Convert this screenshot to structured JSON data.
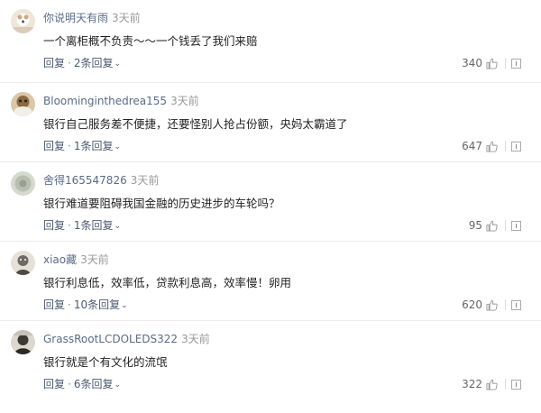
{
  "labels": {
    "reply": "回复",
    "dot": "·"
  },
  "comments": [
    {
      "username": "你说明天有雨",
      "time": "3天前",
      "content": "一个离柜概不负责～～一个钱丢了我们来赔",
      "replies": "2条回复",
      "likes": "340"
    },
    {
      "username": "Bloominginthedrea155",
      "time": "3天前",
      "content": "银行自己服务差不便捷，还要怪别人抢占份额，央妈太霸道了",
      "replies": "1条回复",
      "likes": "647"
    },
    {
      "username": "舍得165547826",
      "time": "3天前",
      "content": "银行难道要阻碍我国金融的历史进步的车轮吗？",
      "replies": "1条回复",
      "likes": "95"
    },
    {
      "username": "xiao藏",
      "time": "3天前",
      "content": "银行利息低，效率低，贷款利息高，效率慢！卵用",
      "replies": "10条回复",
      "likes": "620"
    },
    {
      "username": "GrassRootLCDOLEDS322",
      "time": "3天前",
      "content": "银行就是个有文化的流氓",
      "replies": "6条回复",
      "likes": "322"
    }
  ],
  "colors": {
    "username": "#5a6b86",
    "time": "#999999",
    "link": "#4d5a70"
  }
}
